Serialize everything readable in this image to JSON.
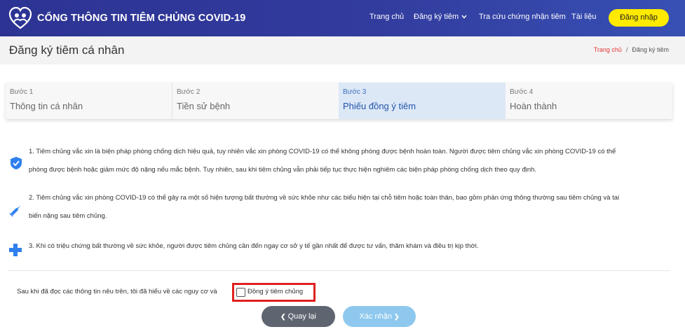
{
  "header": {
    "brand": "CỔNG THÔNG TIN TIÊM CHỦNG COVID-19",
    "nav": {
      "home": "Trang chủ",
      "register": "Đăng ký tiêm",
      "lookup": "Tra cứu chứng nhận tiêm",
      "docs": "Tài liệu"
    },
    "login": "Đăng nhập"
  },
  "page": {
    "title": "Đăng ký tiêm cá nhân",
    "breadcrumb": {
      "home": "Trang chủ",
      "separator": "/",
      "current": "Đăng ký tiêm"
    }
  },
  "steps": [
    {
      "num": "Bước 1",
      "name": "Thông tin cá nhân"
    },
    {
      "num": "Bước 2",
      "name": "Tiền sử bệnh"
    },
    {
      "num": "Bước 3",
      "name": "Phiếu đồng ý tiêm"
    },
    {
      "num": "Bước 4",
      "name": "Hoàn thành"
    }
  ],
  "active_step": 3,
  "terms": [
    {
      "icon": "shield-check-icon",
      "line1": "1. Tiêm chủng vắc xin là biện pháp phòng chống dịch hiệu quả, tuy nhiên vắc xin phòng COVID-19 có thể không phòng được bệnh hoàn toàn. Người được tiêm chủng vắc xin phòng COVID-19 có thể",
      "line2": "phòng được bệnh hoặc giảm mức độ nặng nếu mắc bệnh. Tuy nhiên, sau khi tiêm chủng vẫn phải tiếp tục thực hiện nghiêm các biện pháp phòng chống dịch theo quy định."
    },
    {
      "icon": "syringe-icon",
      "line1": "2. Tiêm chủng vắc xin phòng COVID-19 có thể gây ra một số biểu hiện tại chỗ tiêm hoặc toàn thân, bao gồm phản ứng thông thường sau tiêm chủng và tai",
      "line1_full": "2. Tiêm chủng vắc xin phòng COVID-19 có thể gây ra một số hiện tượng bất thường về sức khỏe như các biểu hiện tại chỗ tiêm hoặc toàn thân, bao gồm phản ứng thông thường sau tiêm chủng và tai",
      "line2": "biến nặng sau tiêm chủng."
    },
    {
      "icon": "medical-cross-icon",
      "line1": "3. Khi có triệu chứng bất thường về sức khỏe, người được tiêm chủng cần đến ngay cơ sở y tế gần nhất để được tư vấn, thăm khám và điều trị kịp thời."
    }
  ],
  "agreement": {
    "text": "Sau khi đã đọc các thông tin nêu trên, tôi đã hiểu về các nguy cơ và",
    "checkbox_label": "Đồng ý tiêm chủng",
    "checked": false
  },
  "buttons": {
    "back": "Quay lại",
    "confirm": "Xác nhận"
  },
  "colors": {
    "header": "#2c3393",
    "login": "#ffea00",
    "active_step": "#dde8f7",
    "back_button": "#5e6571",
    "confirm_button": "#8ec8ee",
    "highlight": "#e02020",
    "icon_blue": "#2f80ed"
  }
}
